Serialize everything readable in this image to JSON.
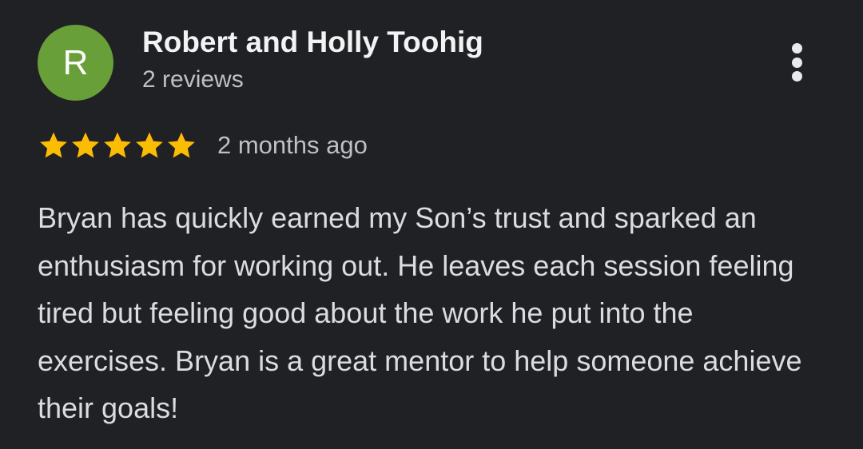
{
  "review": {
    "avatar_initial": "R",
    "author_name": "Robert and Holly Toohig",
    "author_meta": "2 reviews",
    "rating": 5,
    "rating_max": 5,
    "timestamp": "2 months ago",
    "text": "Bryan has quickly earned my Son’s trust and sparked an enthusiasm for working out. He leaves each session feeling tired but feeling good about the work he put into the exercises. Bryan is a great mentor to help someone achieve their goals!"
  },
  "icons": {
    "star": "star-icon",
    "more": "more-vert-icon"
  },
  "colors": {
    "background": "#202124",
    "avatar": "#689f38",
    "star": "#fbbc04",
    "name": "#f1f3f4",
    "secondary": "#bdc1c6",
    "body": "#dadce0"
  }
}
